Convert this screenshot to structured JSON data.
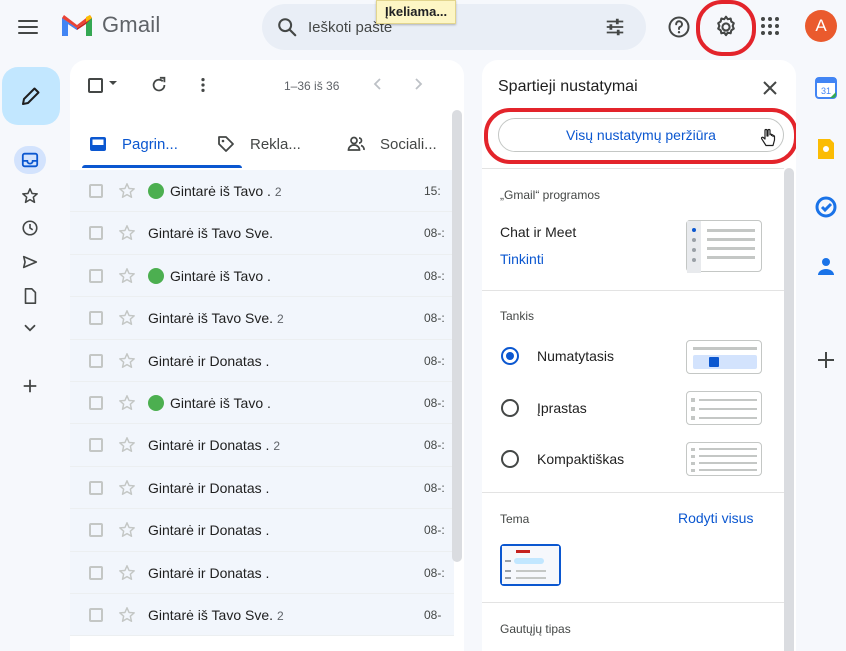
{
  "header": {
    "app_name": "Gmail",
    "search_placeholder": "Ieškoti pašte",
    "loading_tooltip": "Įkeliama...",
    "avatar_letter": "A"
  },
  "list": {
    "count_label": "1–36 iš 36",
    "tabs": [
      {
        "label": "Pagrin...",
        "active": true
      },
      {
        "label": "Rekla..."
      },
      {
        "label": "Sociali..."
      }
    ],
    "rows": [
      {
        "sender": "Gintarė iš Tavo .",
        "count": "2",
        "date": "15:",
        "dot": true
      },
      {
        "sender": "Gintarė iš Tavo Sve.",
        "count": "",
        "date": "08-:",
        "dot": false
      },
      {
        "sender": "Gintarė iš Tavo .",
        "count": "",
        "date": "08-:",
        "dot": true
      },
      {
        "sender": "Gintarė iš Tavo Sve.",
        "count": "2",
        "date": "08-:",
        "dot": false
      },
      {
        "sender": "Gintarė ir Donatas .",
        "count": "",
        "date": "08-:",
        "dot": false
      },
      {
        "sender": "Gintarė iš Tavo .",
        "count": "",
        "date": "08-:",
        "dot": true
      },
      {
        "sender": "Gintarė ir Donatas .",
        "count": "2",
        "date": "08-:",
        "dot": false
      },
      {
        "sender": "Gintarė ir Donatas .",
        "count": "",
        "date": "08-:",
        "dot": false
      },
      {
        "sender": "Gintarė ir Donatas .",
        "count": "",
        "date": "08-:",
        "dot": false
      },
      {
        "sender": "Gintarė ir Donatas .",
        "count": "",
        "date": "08-:",
        "dot": false
      },
      {
        "sender": "Gintarė iš Tavo Sve.",
        "count": "2",
        "date": "08-",
        "dot": false
      }
    ]
  },
  "quick_settings": {
    "title": "Spartieji nustatymai",
    "see_all_button": "Visų nustatymų peržiūra",
    "apps_section": "„Gmail“ programos",
    "chat_meet": "Chat ir Meet",
    "customize_link": "Tinkinti",
    "density_section": "Tankis",
    "density_options": [
      {
        "label": "Numatytasis",
        "selected": true
      },
      {
        "label": "Įprastas",
        "selected": false
      },
      {
        "label": "Kompaktiškas",
        "selected": false
      }
    ],
    "theme_section": "Tema",
    "show_all_link": "Rodyti visus",
    "inbox_type_section": "Gautųjų tipas"
  },
  "colors": {
    "accent_blue": "#0b57d0",
    "highlight_red": "#e3242b",
    "avatar_bg": "#ea5a2d",
    "compose_bg": "#c2e7ff"
  }
}
